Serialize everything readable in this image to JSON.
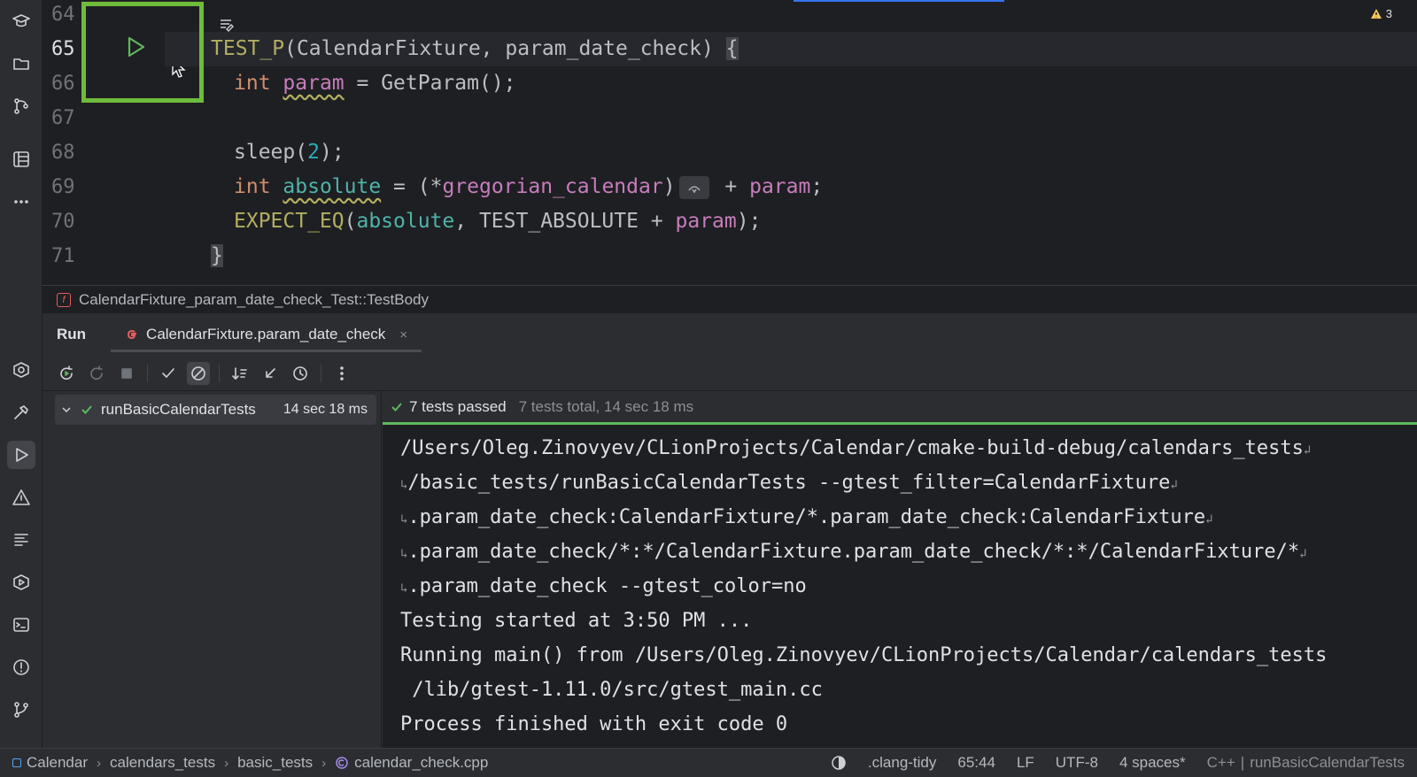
{
  "editor": {
    "line_numbers": [
      "64",
      "65",
      "66",
      "67",
      "68",
      "69",
      "70",
      "71"
    ],
    "lines": {
      "l65": {
        "macro": "TEST_P",
        "open": "(",
        "fixture": "CalendarFixture",
        "comma": ", ",
        "name": "param_date_check",
        "close": ") ",
        "brace": "{"
      },
      "l66": {
        "type": "int",
        "var": "param",
        "rest": " = GetParam();"
      },
      "l68": {
        "fn": "sleep",
        "open": "(",
        "num": "2",
        "close": ");"
      },
      "l69": {
        "type": "int",
        "var": "absolute",
        "eq": " = (*",
        "global": "gregorian_calendar",
        "close": ")",
        "plus": " + ",
        "param": "param",
        "end": ";"
      },
      "l70": {
        "macro": "EXPECT_EQ",
        "open": "(",
        "arg1": "absolute",
        "mid": ", TEST_ABSOLUTE + ",
        "arg2": "param",
        "end": ");"
      },
      "l71": {
        "brace": "}"
      }
    },
    "warning_count": "3"
  },
  "function_breadcrumb": "CalendarFixture_param_date_check_Test::TestBody",
  "run_panel": {
    "title": "Run",
    "tab_label": "CalendarFixture.param_date_check",
    "tab_close": "×",
    "tree": {
      "name": "runBasicCalendarTests",
      "duration": "14 sec 18 ms"
    },
    "status": {
      "passed": "7 tests passed",
      "total": "7 tests total, 14 sec 18 ms"
    },
    "console_lines": [
      "/Users/Oleg.Zinovyev/CLionProjects/Calendar/cmake-build-debug/calendars_tests",
      "/basic_tests/runBasicCalendarTests --gtest_filter=CalendarFixture",
      ".param_date_check:CalendarFixture/*.param_date_check:CalendarFixture",
      ".param_date_check/*:*/CalendarFixture.param_date_check/*:*/CalendarFixture/*",
      ".param_date_check --gtest_color=no",
      "Testing started at 3:50 PM ...",
      "Running main() from /Users/Oleg.Zinovyev/CLionProjects/Calendar/calendars_tests",
      " /lib/gtest-1.11.0/src/gtest_main.cc",
      "Process finished with exit code 0"
    ]
  },
  "statusbar": {
    "crumbs": [
      "Calendar",
      "calendars_tests",
      "basic_tests",
      "calendar_check.cpp"
    ],
    "clang_tidy": ".clang-tidy",
    "position": "65:44",
    "line_ending": "LF",
    "encoding": "UTF-8",
    "indent": "4 spaces*",
    "language": "C++",
    "config": "runBasicCalendarTests"
  },
  "colors": {
    "highlight_box": "#6ebc3a",
    "pass_green": "#5fb85f",
    "accent_blue": "#3574f0"
  }
}
